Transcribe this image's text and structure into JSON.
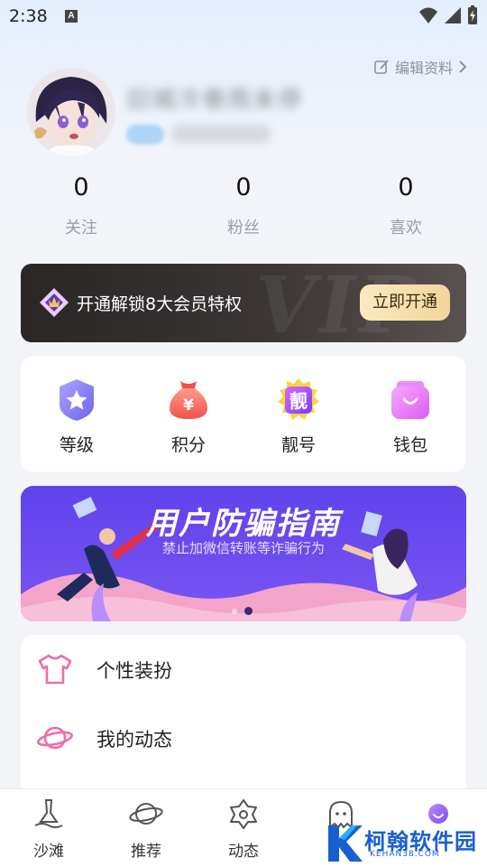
{
  "status_bar": {
    "time": "2:38",
    "a_badge": "A"
  },
  "profile": {
    "edit_label": "编辑资料",
    "nickname": "旧城冷巷雨未停",
    "stats": [
      {
        "count": "0",
        "label": "关注"
      },
      {
        "count": "0",
        "label": "粉丝"
      },
      {
        "count": "0",
        "label": "喜欢"
      }
    ]
  },
  "vip": {
    "text": "开通解锁8大会员特权",
    "button": "立即开通",
    "watermark": "VIP"
  },
  "quick_actions": [
    {
      "label": "等级",
      "icon": "level-star-icon"
    },
    {
      "label": "积分",
      "icon": "points-money-bag-icon"
    },
    {
      "label": "靓号",
      "icon": "pretty-number-icon",
      "glyph": "靓"
    },
    {
      "label": "钱包",
      "icon": "wallet-icon"
    }
  ],
  "promo": {
    "title": "用户防骗指南",
    "subtitle": "禁止加微信转账等诈骗行为",
    "slide_count": 2,
    "active_slide": 2
  },
  "menu": [
    {
      "label": "个性装扮",
      "icon": "tshirt-icon"
    },
    {
      "label": "我的动态",
      "icon": "planet-icon"
    }
  ],
  "bottom_nav": [
    {
      "label": "沙滩",
      "icon": "beach-icon"
    },
    {
      "label": "推荐",
      "icon": "planet-icon"
    },
    {
      "label": "动态",
      "icon": "flower-icon"
    },
    {
      "label": "",
      "icon": "chat-ghost-icon"
    },
    {
      "label": "",
      "icon": "avatar-icon"
    }
  ],
  "watermark": {
    "name": "柯翰软件园",
    "site": "KEHAN38.COM"
  },
  "colors": {
    "accent_purple": "#6a4bf0",
    "vip_gold": "#f3d59c",
    "vip_dark": "#2a2626",
    "pink_icon": "#ef6ba8"
  }
}
